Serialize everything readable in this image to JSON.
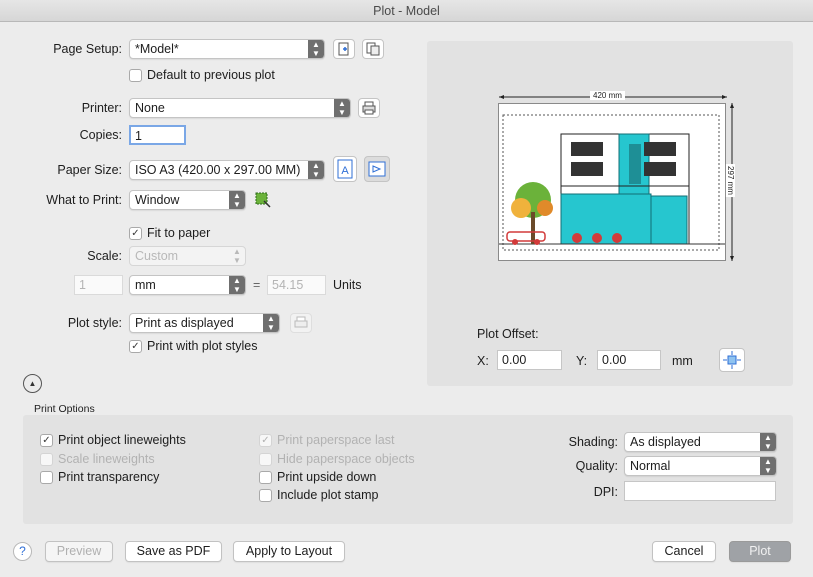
{
  "window": {
    "title": "Plot - Model"
  },
  "page_setup": {
    "label": "Page Setup:",
    "value": "*Model*",
    "default_prev_label": "Default to previous plot",
    "default_prev_checked": false
  },
  "printer": {
    "label": "Printer:",
    "value": "None"
  },
  "copies": {
    "label": "Copies:",
    "value": "1"
  },
  "paper_size": {
    "label": "Paper Size:",
    "value": "ISO A3 (420.00 x 297.00 MM)"
  },
  "what_to_print": {
    "label": "What to Print:",
    "value": "Window"
  },
  "fit_to_paper": {
    "label": "Fit to paper",
    "checked": true
  },
  "scale": {
    "label": "Scale:",
    "value": "Custom",
    "left_value": "1",
    "unit": "mm",
    "equals": "=",
    "right_value": "54.15",
    "units_label": "Units"
  },
  "plot_style": {
    "label": "Plot style:",
    "value": "Print as displayed",
    "with_styles_label": "Print with plot styles",
    "with_styles_checked": true
  },
  "preview": {
    "width_dim": "420 mm",
    "height_dim": "297 mm"
  },
  "plot_offset": {
    "label": "Plot Offset:",
    "x_label": "X:",
    "x_value": "0.00",
    "y_label": "Y:",
    "y_value": "0.00",
    "unit": "mm"
  },
  "print_options": {
    "title": "Print Options",
    "col1": [
      {
        "label": "Print object lineweights",
        "checked": true,
        "enabled": true
      },
      {
        "label": "Scale lineweights",
        "checked": false,
        "enabled": false
      },
      {
        "label": "Print transparency",
        "checked": false,
        "enabled": true
      }
    ],
    "col2": [
      {
        "label": "Print paperspace last",
        "checked": true,
        "enabled": false
      },
      {
        "label": "Hide paperspace objects",
        "checked": false,
        "enabled": false
      },
      {
        "label": "Print upside down",
        "checked": false,
        "enabled": true
      },
      {
        "label": "Include plot stamp",
        "checked": false,
        "enabled": true
      }
    ],
    "shading_label": "Shading:",
    "shading_value": "As displayed",
    "quality_label": "Quality:",
    "quality_value": "Normal",
    "dpi_label": "DPI:",
    "dpi_value": ""
  },
  "footer": {
    "help": "?",
    "preview": "Preview",
    "save_pdf": "Save as PDF",
    "apply_layout": "Apply to Layout",
    "cancel": "Cancel",
    "plot": "Plot"
  },
  "glyphs": {
    "check": "✓",
    "up": "▲",
    "down": "▼"
  },
  "colors": {
    "accent_blue": "#2f6fd6",
    "building_cyan": "#26c6cf",
    "tree_green": "#6bb23a",
    "car_red": "#d23a3a"
  }
}
